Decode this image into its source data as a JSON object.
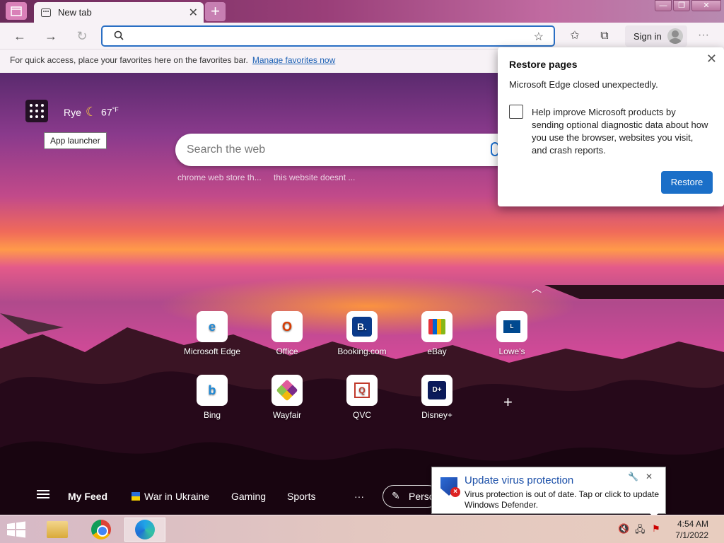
{
  "browser": {
    "tab_title": "New tab",
    "tab_close": "✕",
    "new_tab": "+",
    "window_buttons": [
      "—",
      "❐",
      "✕"
    ],
    "address_placeholder": "",
    "sign_in": "Sign in",
    "more": "···"
  },
  "favorites_bar": {
    "message": "For quick access, place your favorites here on the favorites bar.",
    "link": "Manage favorites now"
  },
  "newtab": {
    "tooltip": "App launcher",
    "weather_location": "Rye",
    "weather_temp": "67",
    "weather_unit": "°F",
    "search_placeholder": "Search the web",
    "suggestions": [
      "chrome web store th...",
      "this website doesnt ..."
    ],
    "tiles": [
      {
        "label": "Microsoft Edge",
        "glyph": "e",
        "color": "#1f8ad6"
      },
      {
        "label": "Office",
        "glyph": "O",
        "color": "#d83b01"
      },
      {
        "label": "Booking.com",
        "glyph": "B.",
        "color": "#ffffff"
      },
      {
        "label": "eBay",
        "glyph": "🛍",
        "color": "#333333"
      },
      {
        "label": "Lowe's",
        "glyph": "L",
        "color": "#ffffff"
      },
      {
        "label": "Bing",
        "glyph": "b",
        "color": "#1f8ad6"
      },
      {
        "label": "Wayfair",
        "glyph": "✿",
        "color": "#7a2a8a"
      },
      {
        "label": "QVC",
        "glyph": "Q",
        "color": "#c0392b"
      },
      {
        "label": "Disney+",
        "glyph": "D+",
        "color": "#ffffff"
      }
    ],
    "add_tile": "+"
  },
  "feed": {
    "items": [
      "My Feed",
      "War in Ukraine",
      "Gaming",
      "Sports",
      "···"
    ],
    "personalize": "Perso"
  },
  "restore_popup": {
    "title": "Restore pages",
    "message": "Microsoft Edge closed unexpectedly.",
    "checkbox_text": "Help improve Microsoft products by sending optional diagnostic data about how you use the browser, websites you visit, and crash reports.",
    "button": "Restore",
    "close": "✕"
  },
  "toast": {
    "title": "Update virus protection",
    "message": "Virus protection is out of date. Tap or click to update Windows Defender.",
    "tools": "🔧✕"
  },
  "taskbar": {
    "time": "4:54 AM",
    "date": "7/1/2022"
  }
}
